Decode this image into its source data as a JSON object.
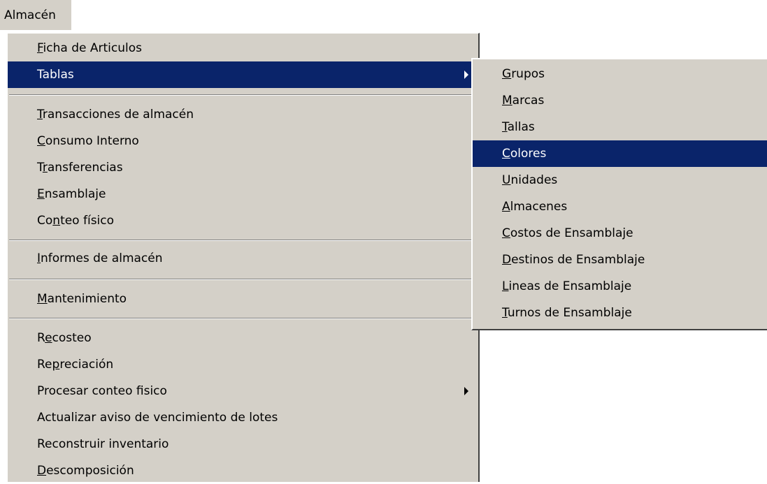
{
  "menubar": {
    "title": "Almacén"
  },
  "menu": {
    "items": [
      {
        "pre": "",
        "mn": "F",
        "post": "icha de Articulos"
      },
      {
        "pre": "Tablas",
        "mn": "",
        "post": ""
      },
      {
        "pre": "",
        "mn": "T",
        "post": "ransacciones de almacén"
      },
      {
        "pre": "",
        "mn": "C",
        "post": "onsumo Interno"
      },
      {
        "pre": "T",
        "mn": "r",
        "post": "ansferencias"
      },
      {
        "pre": "",
        "mn": "E",
        "post": "nsamblaje"
      },
      {
        "pre": "Co",
        "mn": "n",
        "post": "teo físico"
      },
      {
        "pre": "",
        "mn": "I",
        "post": "nformes de almacén"
      },
      {
        "pre": "",
        "mn": "M",
        "post": "antenimiento"
      },
      {
        "pre": "R",
        "mn": "e",
        "post": "costeo"
      },
      {
        "pre": "Re",
        "mn": "p",
        "post": "reciación"
      },
      {
        "pre": "Procesar conteo fisico",
        "mn": "",
        "post": ""
      },
      {
        "pre": "Actualizar aviso de vencimiento de lotes",
        "mn": "",
        "post": ""
      },
      {
        "pre": "Reconstruir inventario",
        "mn": "",
        "post": ""
      },
      {
        "pre": "",
        "mn": "D",
        "post": "escomposición"
      }
    ]
  },
  "submenu": {
    "items": [
      {
        "pre": "",
        "mn": "G",
        "post": "rupos"
      },
      {
        "pre": "",
        "mn": "M",
        "post": "arcas"
      },
      {
        "pre": "",
        "mn": "T",
        "post": "allas"
      },
      {
        "pre": "",
        "mn": "C",
        "post": "olores"
      },
      {
        "pre": "",
        "mn": "U",
        "post": "nidades"
      },
      {
        "pre": "",
        "mn": "A",
        "post": "lmacenes"
      },
      {
        "pre": "",
        "mn": "C",
        "post": "ostos de Ensamblaje"
      },
      {
        "pre": "",
        "mn": "D",
        "post": "estinos de Ensamblaje"
      },
      {
        "pre": "",
        "mn": "L",
        "post": "ineas de Ensamblaje"
      },
      {
        "pre": "",
        "mn": "T",
        "post": "urnos de Ensamblaje"
      }
    ]
  },
  "colors": {
    "menu_bg": "#d4d0c8",
    "highlight": "#0a246a",
    "highlight_text": "#ffffff"
  }
}
